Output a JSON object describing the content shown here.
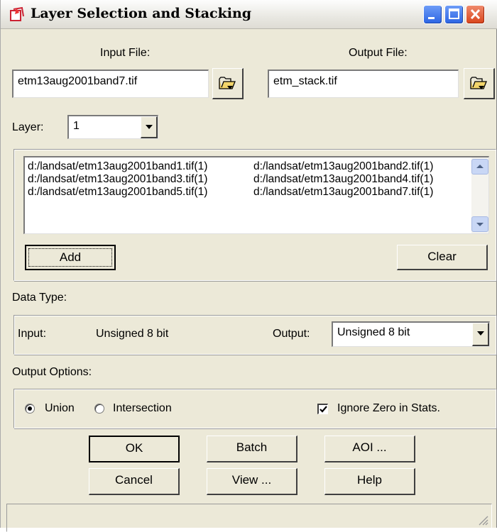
{
  "window": {
    "title": "Layer Selection and Stacking"
  },
  "input_file": {
    "label": "Input File:",
    "value": "etm13aug2001band7.tif"
  },
  "output_file": {
    "label": "Output File:",
    "value": "etm_stack.tif"
  },
  "layer": {
    "label": "Layer:",
    "value": "1"
  },
  "layer_list": {
    "items": [
      "d:/landsat/etm13aug2001band1.tif(1)",
      "d:/landsat/etm13aug2001band2.tif(1)",
      "d:/landsat/etm13aug2001band3.tif(1)",
      "d:/landsat/etm13aug2001band4.tif(1)",
      "d:/landsat/etm13aug2001band5.tif(1)",
      "d:/landsat/etm13aug2001band7.tif(1)"
    ],
    "add_label": "Add",
    "clear_label": "Clear"
  },
  "data_type": {
    "section_label": "Data Type:",
    "input_label": "Input:",
    "input_value": "Unsigned 8 bit",
    "output_label": "Output:",
    "output_value": "Unsigned 8 bit"
  },
  "output_options": {
    "section_label": "Output Options:",
    "union_label": "Union",
    "intersection_label": "Intersection",
    "selected": "Union",
    "ignore_zero_label": "Ignore Zero in Stats.",
    "ignore_zero_checked": true
  },
  "buttons": {
    "ok": "OK",
    "batch": "Batch",
    "aoi": "AOI ...",
    "cancel": "Cancel",
    "view": "View ...",
    "help": "Help"
  }
}
